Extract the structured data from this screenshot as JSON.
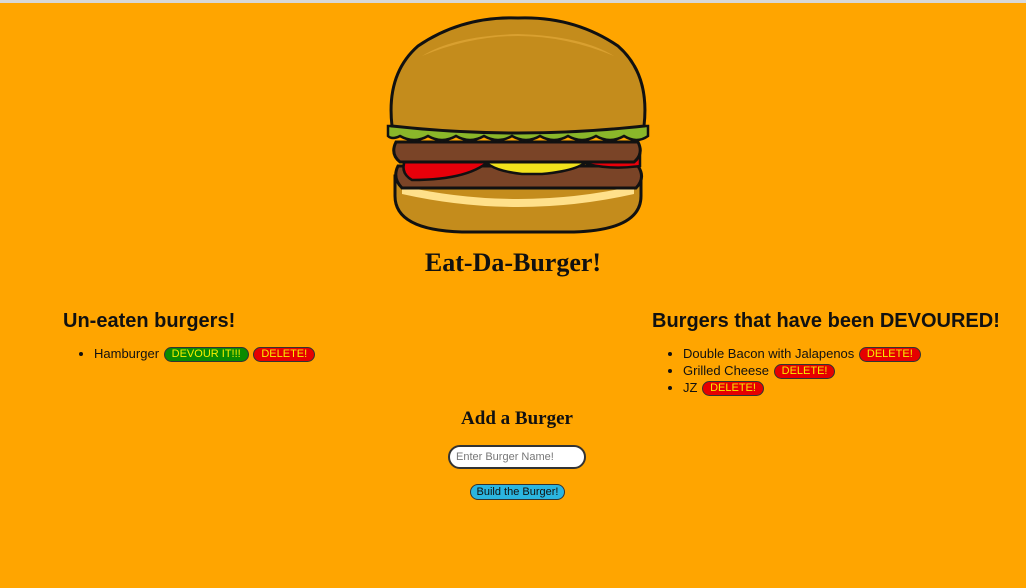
{
  "header": {
    "title": "Eat-Da-Burger!"
  },
  "uneaten": {
    "heading": "Un-eaten burgers!",
    "items": [
      {
        "name": "Hamburger",
        "devour_label": "DEVOUR IT!!!",
        "delete_label": "DELETE!"
      }
    ]
  },
  "devoured": {
    "heading": "Burgers that have been DEVOURED!",
    "items": [
      {
        "name": "Double Bacon with Jalapenos",
        "delete_label": "DELETE!"
      },
      {
        "name": "Grilled Cheese",
        "delete_label": "DELETE!"
      },
      {
        "name": "JZ",
        "delete_label": "DELETE!"
      }
    ]
  },
  "add_form": {
    "heading": "Add a Burger",
    "placeholder": "Enter Burger Name!",
    "submit_label": "Build the Burger!"
  },
  "colors": {
    "background": "#FFA500",
    "devour_button": "#0a8a00",
    "delete_button": "#e60000",
    "button_text": "#f6ef00",
    "build_button": "#2bb5e0"
  }
}
